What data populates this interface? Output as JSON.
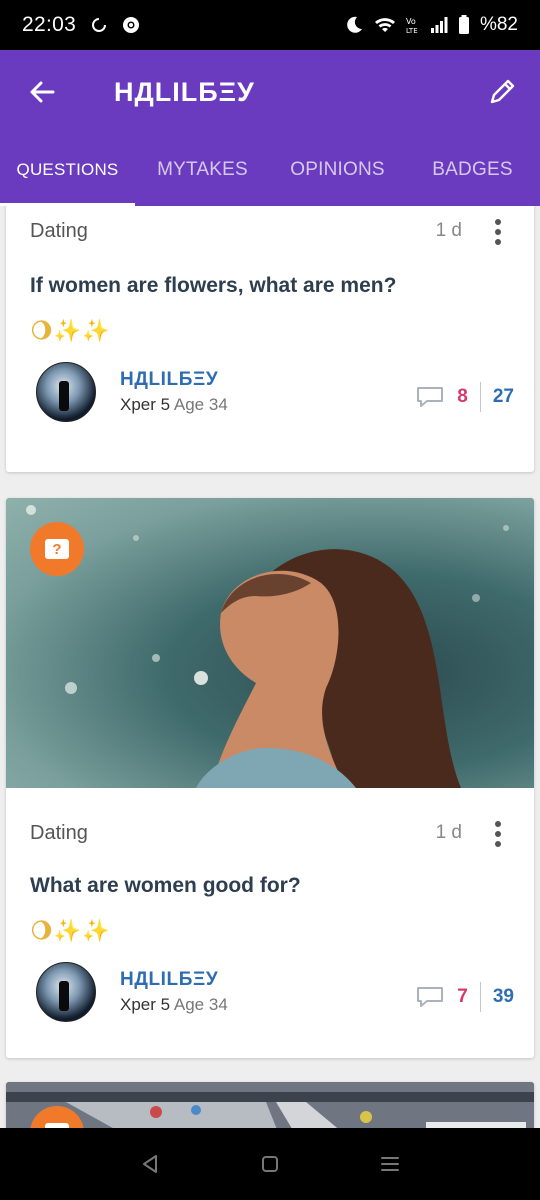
{
  "status_bar": {
    "time": "22:03",
    "battery": "%82",
    "icons": [
      "sync-icon",
      "chrome-icon",
      "moon-icon",
      "wifi-icon",
      "volte-icon",
      "signal-icon",
      "battery-icon"
    ]
  },
  "app_bar": {
    "title": "НДLILБΞУ",
    "back_icon": "arrow-left-icon",
    "edit_icon": "pencil-icon",
    "background": "#6a3bbf"
  },
  "tabs": [
    {
      "label": "QUESTIONS",
      "active": true
    },
    {
      "label": "MYTAKES",
      "active": false
    },
    {
      "label": "OPINIONS",
      "active": false
    },
    {
      "label": "BADGES",
      "active": false
    }
  ],
  "cards": [
    {
      "topic": "Dating",
      "age": "1 d",
      "title": "If women are flowers, what are men?",
      "emoji": "🌖✨✨",
      "author": {
        "name": "НДLILБΞУ",
        "xper": "Xper 5",
        "age_label": "Age 34"
      },
      "comments": "8",
      "votes": "27"
    },
    {
      "topic": "Dating",
      "age": "1 d",
      "title": "What are women good for?",
      "emoji": "🌖✨✨",
      "author": {
        "name": "НДLILБΞУ",
        "xper": "Xper 5",
        "age_label": "Age 34"
      },
      "comments": "7",
      "votes": "39"
    }
  ],
  "colors": {
    "accent": "#6a3bbf",
    "author_link": "#2e6db4",
    "comment_count": "#d63a6b",
    "question_badge": "#f07a2a"
  }
}
